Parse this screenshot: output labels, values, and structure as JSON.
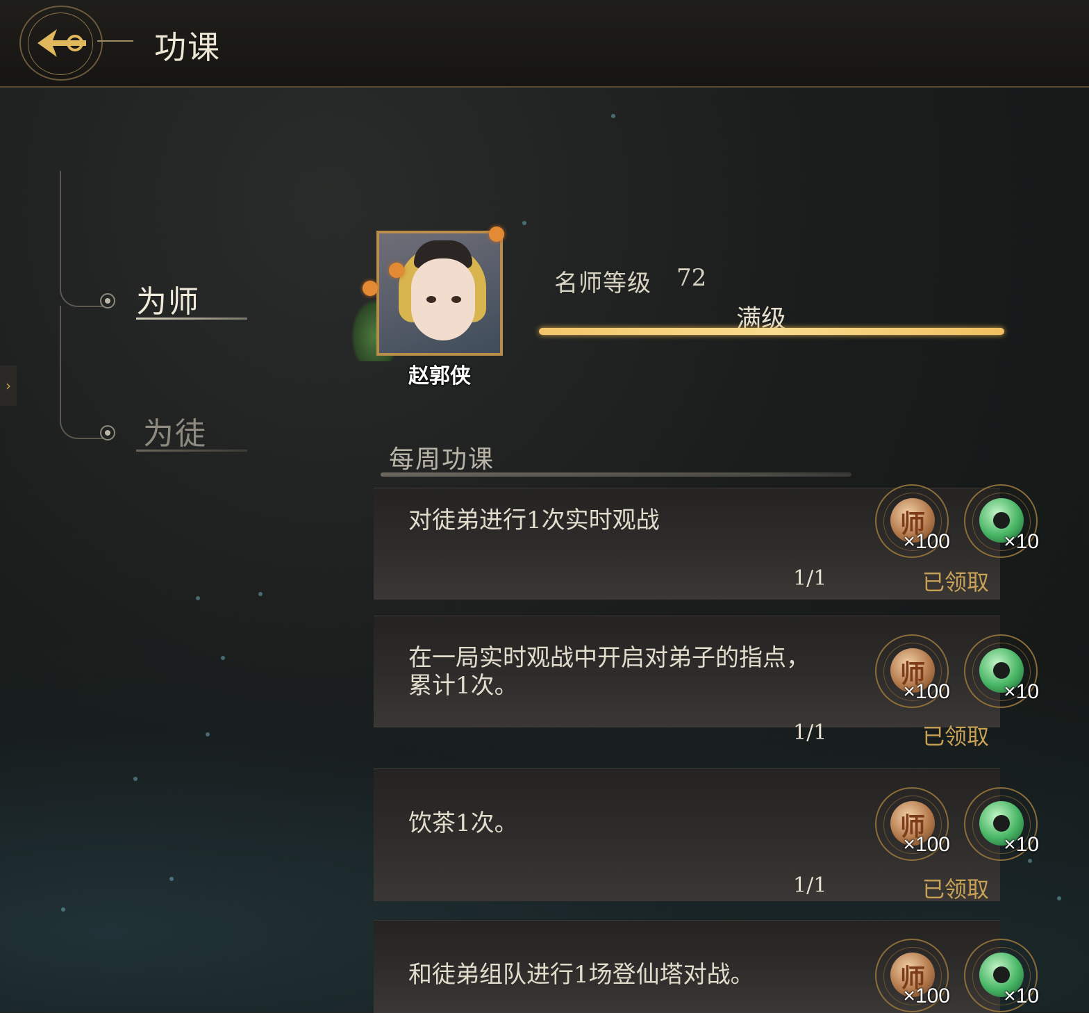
{
  "header": {
    "title": "功课"
  },
  "nav": {
    "items": [
      {
        "label": "为师",
        "active": true
      },
      {
        "label": "为徒",
        "active": false
      }
    ]
  },
  "profile": {
    "name": "赵郭侠",
    "level_label": "名师等级",
    "level_value": "72",
    "exp_status": "满级",
    "exp_progress_fraction": 1.0
  },
  "weekly": {
    "title": "每周功课",
    "tasks": [
      {
        "description": "对徒弟进行1次实时观战",
        "progress": "1/1",
        "status": "已领取",
        "rewards": [
          {
            "icon": "master-coin-icon",
            "glyph": "师",
            "count": "×100"
          },
          {
            "icon": "jade-disc-icon",
            "count": "×10"
          }
        ]
      },
      {
        "description": "在一局实时观战中开启对弟子的指点，累计1次。",
        "progress": "1/1",
        "status": "已领取",
        "rewards": [
          {
            "icon": "master-coin-icon",
            "glyph": "师",
            "count": "×100"
          },
          {
            "icon": "jade-disc-icon",
            "count": "×10"
          }
        ]
      },
      {
        "description": "饮茶1次。",
        "progress": "1/1",
        "status": "已领取",
        "rewards": [
          {
            "icon": "master-coin-icon",
            "glyph": "师",
            "count": "×100"
          },
          {
            "icon": "jade-disc-icon",
            "count": "×10"
          }
        ]
      },
      {
        "description": "和徒弟组队进行1场登仙塔对战。",
        "progress": "",
        "status": "",
        "rewards": [
          {
            "icon": "master-coin-icon",
            "glyph": "师",
            "count": "×100"
          },
          {
            "icon": "jade-disc-icon",
            "count": "×10"
          }
        ]
      }
    ]
  },
  "colors": {
    "accent_gold": "#c7a156",
    "exp_bar": "#f9dc8f",
    "background": "#1a1d1c"
  }
}
